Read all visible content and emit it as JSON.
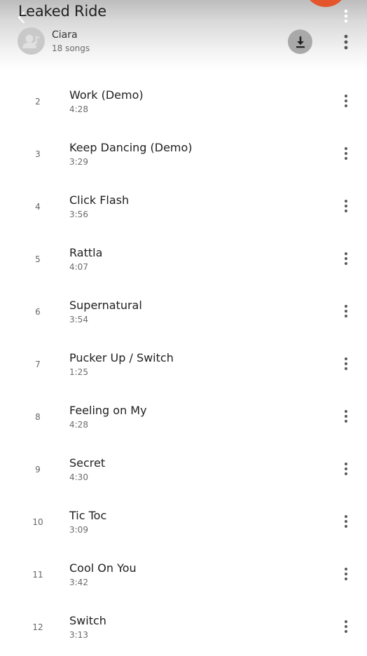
{
  "header": {
    "title": "Leaked Ride",
    "artist": "Ciara",
    "song_count": "18 songs",
    "icons": {
      "back": "arrow-left-icon",
      "download": "download-icon",
      "menu": "more-vert-icon",
      "avatar": "artist-placeholder-icon"
    }
  },
  "colors": {
    "fab": "#e4552c",
    "download_bg": "#a9a9a9",
    "avatar_bg": "#c9c9c9",
    "text_primary": "#202020",
    "text_secondary": "#6b6b6b"
  },
  "tracks": [
    {
      "number": "2",
      "title": "Work (Demo)",
      "duration": "4:28"
    },
    {
      "number": "3",
      "title": "Keep Dancing (Demo)",
      "duration": "3:29"
    },
    {
      "number": "4",
      "title": "Click Flash",
      "duration": "3:56"
    },
    {
      "number": "5",
      "title": "Rattla",
      "duration": "4:07"
    },
    {
      "number": "6",
      "title": "Supernatural",
      "duration": "3:54"
    },
    {
      "number": "7",
      "title": "Pucker Up / Switch",
      "duration": "1:25"
    },
    {
      "number": "8",
      "title": "Feeling on My",
      "duration": "4:28"
    },
    {
      "number": "9",
      "title": "Secret",
      "duration": "4:30"
    },
    {
      "number": "10",
      "title": "Tic Toc",
      "duration": "3:09"
    },
    {
      "number": "11",
      "title": "Cool On You",
      "duration": "3:42"
    },
    {
      "number": "12",
      "title": "Switch",
      "duration": "3:13"
    }
  ]
}
